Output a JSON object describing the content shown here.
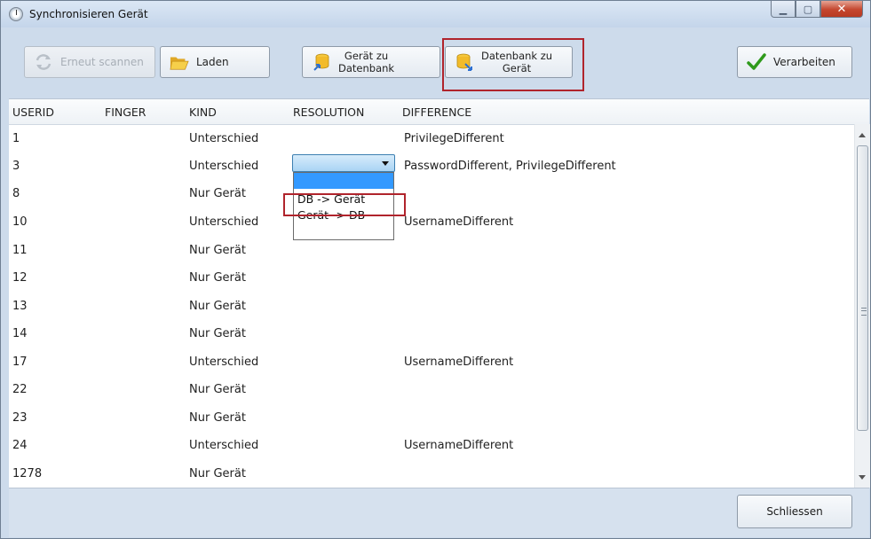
{
  "window": {
    "title": "Synchronisieren Gerät",
    "accent": "#b0242c"
  },
  "toolbar": {
    "rescan_label": "Erneut scannen",
    "load_label": "Laden",
    "device_to_db_line1": "Gerät zu",
    "device_to_db_line2": "Datenbank",
    "db_to_device_line1": "Datenbank zu",
    "db_to_device_line2": "Gerät",
    "process_label": "Verarbeiten"
  },
  "columns": [
    "USERID",
    "FINGER",
    "KIND",
    "RESOLUTION",
    "DIFFERENCE"
  ],
  "rows": [
    {
      "userid": "1",
      "finger": "",
      "kind": "Unterschied",
      "resolution": "",
      "difference": "PrivilegeDifferent"
    },
    {
      "userid": "3",
      "finger": "",
      "kind": "Unterschied",
      "resolution": "",
      "difference": "PasswordDifferent, PrivilegeDifferent"
    },
    {
      "userid": "8",
      "finger": "",
      "kind": "Nur Gerät",
      "resolution": "",
      "difference": ""
    },
    {
      "userid": "10",
      "finger": "",
      "kind": "Unterschied",
      "resolution": "",
      "difference": "UsernameDifferent"
    },
    {
      "userid": "11",
      "finger": "",
      "kind": "Nur Gerät",
      "resolution": "",
      "difference": ""
    },
    {
      "userid": "12",
      "finger": "",
      "kind": "Nur Gerät",
      "resolution": "",
      "difference": ""
    },
    {
      "userid": "13",
      "finger": "",
      "kind": "Nur Gerät",
      "resolution": "",
      "difference": ""
    },
    {
      "userid": "14",
      "finger": "",
      "kind": "Nur Gerät",
      "resolution": "",
      "difference": ""
    },
    {
      "userid": "17",
      "finger": "",
      "kind": "Unterschied",
      "resolution": "",
      "difference": "UsernameDifferent"
    },
    {
      "userid": "22",
      "finger": "",
      "kind": "Nur Gerät",
      "resolution": "",
      "difference": ""
    },
    {
      "userid": "23",
      "finger": "",
      "kind": "Nur Gerät",
      "resolution": "",
      "difference": ""
    },
    {
      "userid": "24",
      "finger": "",
      "kind": "Unterschied",
      "resolution": "",
      "difference": "UsernameDifferent"
    },
    {
      "userid": "1278",
      "finger": "",
      "kind": "Nur Gerät",
      "resolution": "",
      "difference": ""
    }
  ],
  "resolution_options": [
    "",
    "DB -> Gerät",
    "Gerät -> DB"
  ],
  "footer": {
    "close_label": "Schliessen"
  }
}
